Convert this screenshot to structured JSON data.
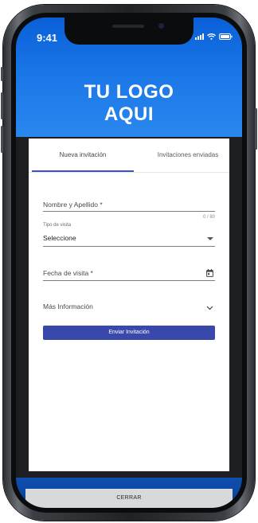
{
  "status_bar": {
    "time": "9:41"
  },
  "header": {
    "logo_line1": "TU LOGO",
    "logo_line2": "AQUI"
  },
  "tabs": [
    {
      "label": "Nueva invitación",
      "active": true
    },
    {
      "label": "Invitaciones enviadas",
      "active": false
    }
  ],
  "form": {
    "name_label": "Nombre y Apellido *",
    "name_counter": "0 / 80",
    "visit_type_label": "Tipo de visita",
    "visit_type_value": "Seleccione",
    "visit_date_label": "Fecha de visita *",
    "more_info_label": "Más Información",
    "submit_label": "Enviar Invitación"
  },
  "footer": {
    "close_label": "CERRAR"
  },
  "colors": {
    "header_blue": "#1976e6",
    "accent": "#3f51b5",
    "button": "#3949ab",
    "close_button": "#d7d9db"
  },
  "icons": [
    "signal-icon",
    "wifi-icon",
    "battery-icon",
    "dropdown-caret-icon",
    "calendar-icon",
    "chevron-down-icon"
  ]
}
